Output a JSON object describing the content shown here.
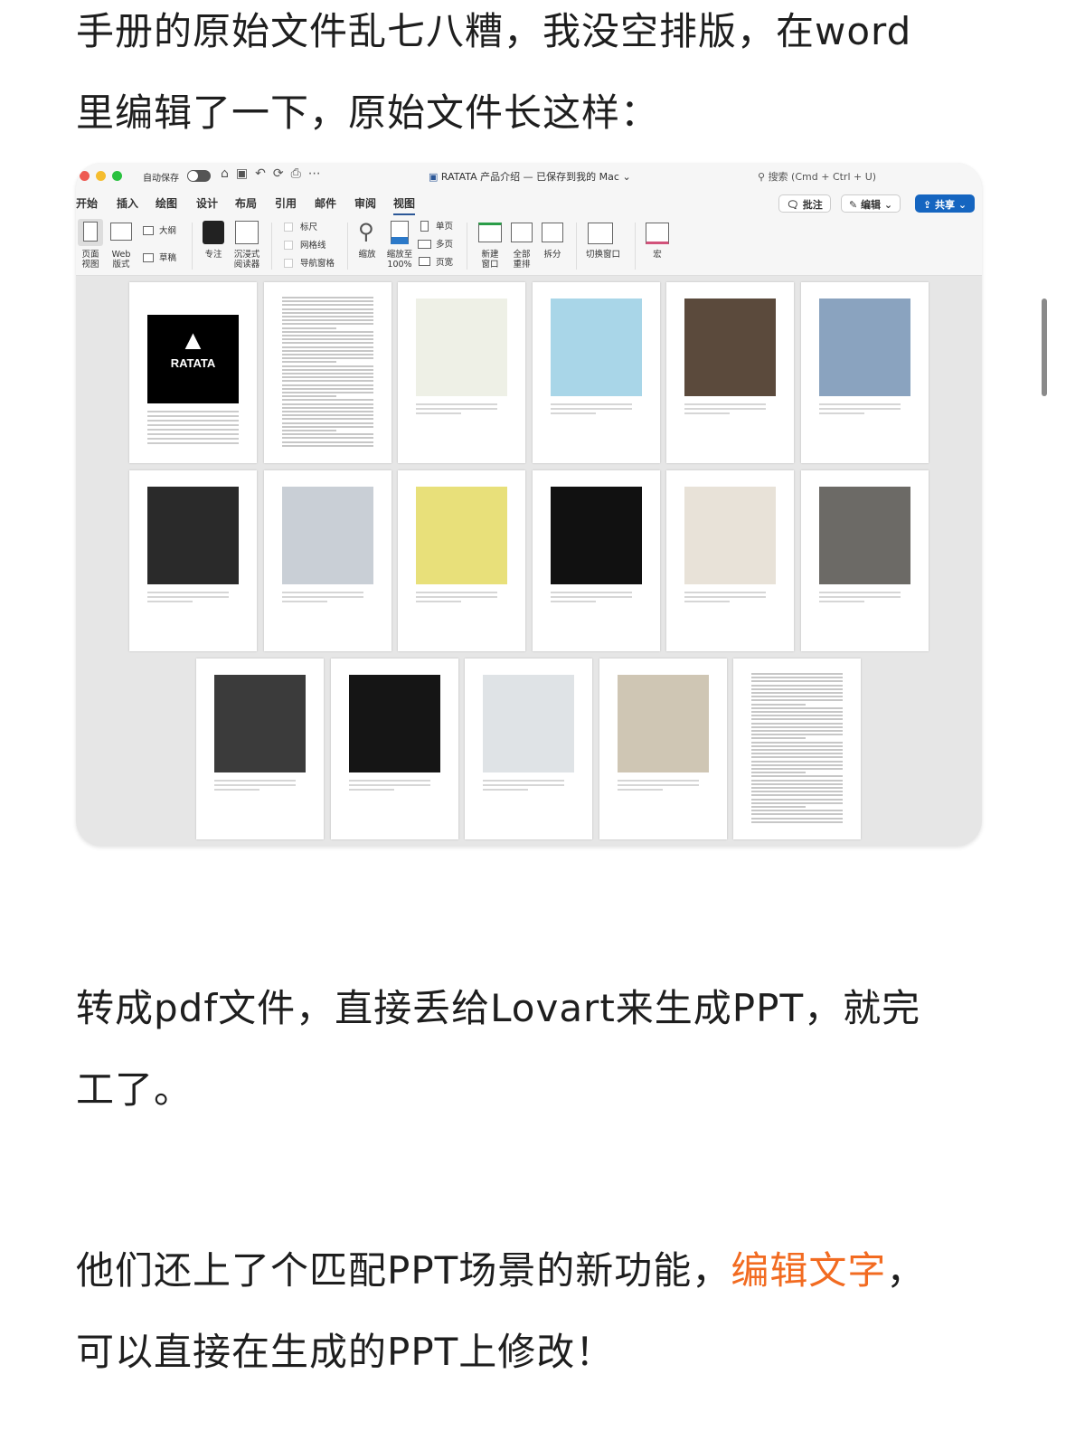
{
  "article": {
    "para1_line1": "手册的原始文件乱七八糟，我没空排版，在word",
    "para1_line2": "里编辑了一下，原始文件长这样：",
    "para2_line1": "转成pdf文件，直接丢给Lovart来生成PPT，就完",
    "para2_line2": "工了。",
    "para3_line1_pre": "他们还上了个匹配PPT场景的新功能，",
    "para3_line1_highlight": "编辑文字",
    "para3_line1_post": "，",
    "para3_line2": "可以直接在生成的PPT上修改！",
    "highlight_color": "#f26b21"
  },
  "word": {
    "autosave_label": "自动保存",
    "doc_title": "RATATA 产品介绍 — 已保存到我的 Mac",
    "search_placeholder": "搜索 (Cmd + Ctrl + U)",
    "tabs": [
      "开始",
      "插入",
      "绘图",
      "设计",
      "布局",
      "引用",
      "邮件",
      "审阅",
      "视图"
    ],
    "active_tab": "视图",
    "comment_button": "批注",
    "edit_button": "编辑",
    "share_button": "共享",
    "ribbon": {
      "page_view": "页面\n视图",
      "web_layout": "Web\n版式",
      "outline": "大纲",
      "draft": "草稿",
      "focus": "专注",
      "immersive_reader": "沉浸式\n阅读器",
      "ruler": "标尺",
      "gridlines": "网格线",
      "nav_pane": "导航窗格",
      "zoom": "缩放",
      "zoom100": "缩放至\n100%",
      "one_page": "单页",
      "multi_page": "多页",
      "page_width": "页宽",
      "new_window": "新建\n窗口",
      "arrange_all": "全部\n重排",
      "split": "拆分",
      "switch_window": "切换窗口",
      "macros": "宏"
    },
    "logo_text": "RATATA",
    "share_color": "#1565c0"
  }
}
